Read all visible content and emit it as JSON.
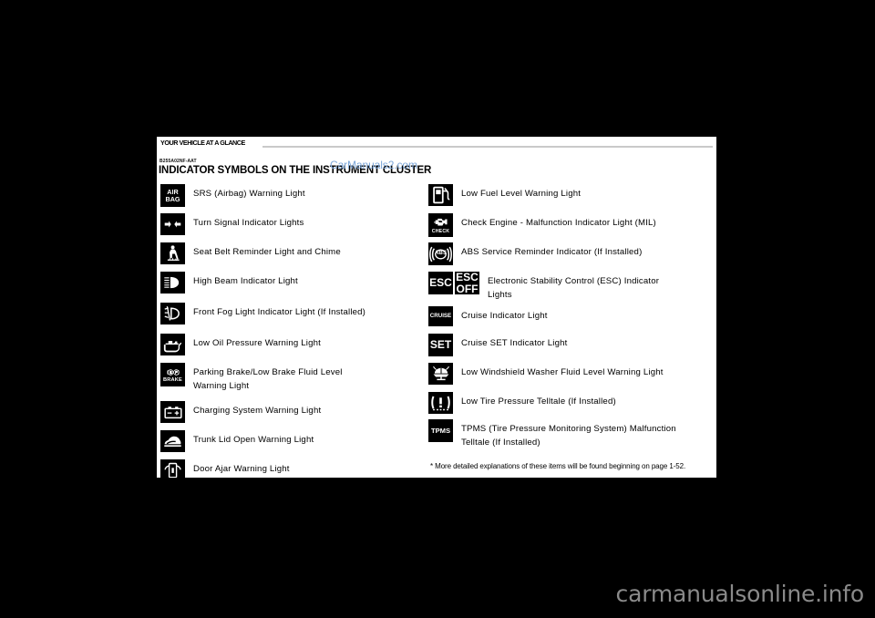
{
  "page": {
    "running_head": "YOUR VEHICLE AT A GLANCE",
    "doc_code": "B255A02NF-AAT",
    "title": "INDICATOR SYMBOLS ON THE INSTRUMENT CLUSTER",
    "watermark": "CarManuals2.com",
    "footnote": "* More detailed explanations of these items will be found beginning on page 1-52.",
    "site_watermark": "carmanualsonline.info",
    "colors": {
      "background": "#000000",
      "page": "#ffffff",
      "text": "#000000",
      "rule": "#c9c9c9",
      "watermark": "#7da7d9",
      "site_watermark": "#8a8a8a"
    }
  },
  "left_column": [
    {
      "icon": "airbag-srs-icon",
      "tile_text": "AIR\nBAG",
      "label": "SRS (Airbag) Warning Light"
    },
    {
      "icon": "turn-signal-arrows-icon",
      "tile_text": "",
      "label": "Turn Signal Indicator Lights"
    },
    {
      "icon": "seat-belt-icon",
      "tile_text": "",
      "label": "Seat Belt Reminder Light and Chime"
    },
    {
      "icon": "high-beam-icon",
      "tile_text": "",
      "label": "High Beam Indicator Light"
    },
    {
      "icon": "front-fog-light-icon",
      "tile_text": "",
      "label": "Front Fog Light Indicator Light (If Installed)"
    },
    {
      "icon": "oil-can-icon",
      "tile_text": "",
      "label": "Low Oil Pressure Warning Light"
    },
    {
      "icon": "parking-brake-icon",
      "tile_text": "BRAKE",
      "label": "Parking Brake/Low Brake Fluid Level\nWarning Light"
    },
    {
      "icon": "battery-icon",
      "tile_text": "",
      "label": "Charging System Warning Light"
    },
    {
      "icon": "trunk-open-icon",
      "tile_text": "",
      "label": "Trunk Lid Open Warning Light"
    },
    {
      "icon": "door-ajar-icon",
      "tile_text": "",
      "label": "Door Ajar Warning Light"
    }
  ],
  "right_column": [
    {
      "icon": "fuel-pump-icon",
      "tile_text": "",
      "label": "Low Fuel Level Warning Light"
    },
    {
      "icon": "check-engine-icon",
      "tile_text": "CHECK",
      "label": "Check Engine - Malfunction Indicator Light (MIL)"
    },
    {
      "icon": "abs-icon",
      "tile_text": "ABS",
      "label": "ABS Service Reminder Indicator (If Installed)"
    },
    {
      "icon": "esc-icon",
      "tile_text": "ESC",
      "tile_text_2": "ESC\nOFF",
      "label": "Electronic Stability Control (ESC) Indicator\nLights"
    },
    {
      "icon": "cruise-icon",
      "tile_text": "CRUISE",
      "label": "Cruise Indicator Light"
    },
    {
      "icon": "cruise-set-icon",
      "tile_text": "SET",
      "label": "Cruise SET Indicator Light"
    },
    {
      "icon": "washer-fluid-icon",
      "tile_text": "",
      "label": "Low Windshield Washer Fluid Level Warning Light"
    },
    {
      "icon": "tire-pressure-icon",
      "tile_text": "",
      "label": "Low Tire Pressure Telltale (If Installed)"
    },
    {
      "icon": "tpms-icon",
      "tile_text": "TPMS",
      "label": "TPMS (Tire Pressure Monitoring System) Malfunction\nTelltale (If Installed)"
    }
  ]
}
